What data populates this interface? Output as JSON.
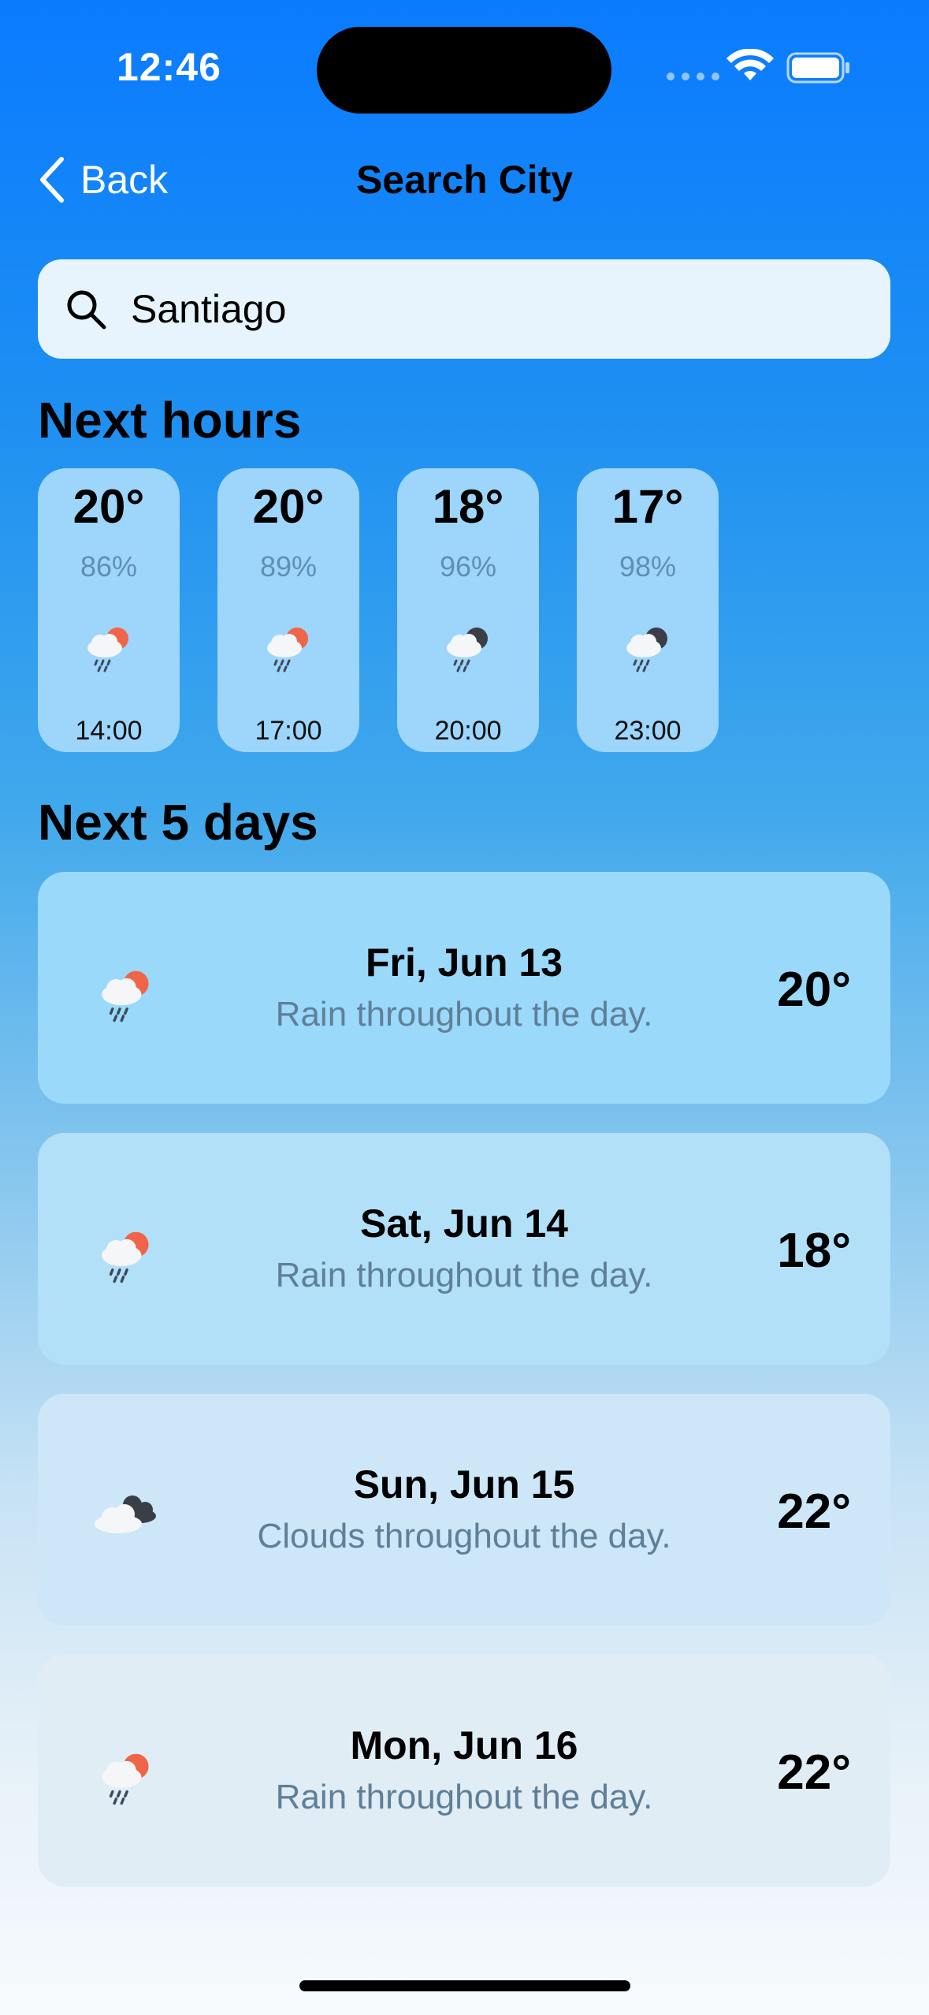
{
  "status_bar": {
    "time": "12:46"
  },
  "nav": {
    "back_label": "Back",
    "title": "Search City"
  },
  "search": {
    "value": "Santiago",
    "placeholder": ""
  },
  "next_hours": {
    "title": "Next hours",
    "items": [
      {
        "temp": "20°",
        "humidity": "86%",
        "time": "14:00",
        "icon": "rain-sun-icon"
      },
      {
        "temp": "20°",
        "humidity": "89%",
        "time": "17:00",
        "icon": "rain-sun-icon"
      },
      {
        "temp": "18°",
        "humidity": "96%",
        "time": "20:00",
        "icon": "rain-moon-icon"
      },
      {
        "temp": "17°",
        "humidity": "98%",
        "time": "23:00",
        "icon": "rain-moon-icon"
      }
    ]
  },
  "next_days": {
    "title": "Next 5 days",
    "items": [
      {
        "date": "Fri, Jun 13",
        "desc": "Rain throughout the day.",
        "temp": "20°",
        "icon": "rain-sun-icon"
      },
      {
        "date": "Sat, Jun 14",
        "desc": "Rain throughout the day.",
        "temp": "18°",
        "icon": "rain-sun-icon"
      },
      {
        "date": "Sun, Jun 15",
        "desc": "Clouds throughout the day.",
        "temp": "22°",
        "icon": "clouds-icon"
      },
      {
        "date": "Mon, Jun 16",
        "desc": "Rain throughout the day.",
        "temp": "22°",
        "icon": "rain-sun-icon"
      }
    ]
  },
  "colors": {
    "accent": "#0a7bff",
    "hour_card": "#9dd5fb",
    "search_bg": "#e8f4fd",
    "muted_text": "#5f7f98"
  }
}
